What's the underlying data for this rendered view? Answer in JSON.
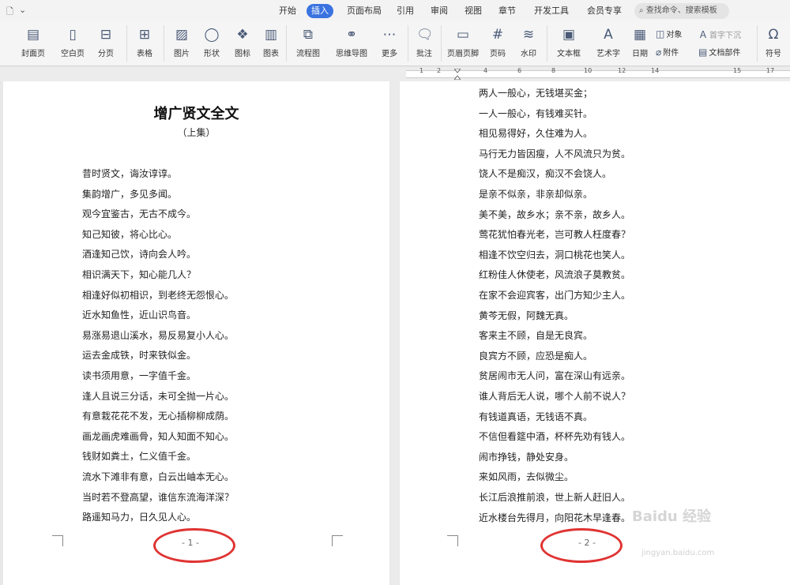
{
  "menubar": {
    "tabs": [
      {
        "label": "开始",
        "active": false
      },
      {
        "label": "插入",
        "active": true
      },
      {
        "label": "页面布局",
        "active": false
      },
      {
        "label": "引用",
        "active": false
      },
      {
        "label": "审阅",
        "active": false
      },
      {
        "label": "视图",
        "active": false
      },
      {
        "label": "章节",
        "active": false
      },
      {
        "label": "开发工具",
        "active": false
      },
      {
        "label": "会员专享",
        "active": false
      }
    ],
    "search_placeholder": "查找命令、搜索模板"
  },
  "ribbon": {
    "cover_page": "封面页",
    "blank_page": "空白页",
    "page_break": "分页",
    "table": "表格",
    "picture": "图片",
    "shape": "形状",
    "icon": "图标",
    "chart": "图表",
    "flowchart": "流程图",
    "mindmap": "思维导图",
    "more": "更多",
    "comment": "批注",
    "header_footer": "页眉页脚",
    "page_number": "页码",
    "watermark": "水印",
    "textbox": "文本框",
    "wordart": "艺术字",
    "date": "日期",
    "object": "对象",
    "attachment": "附件",
    "dropcap": "首字下沉",
    "doc_parts": "文档部件",
    "symbol": "符号"
  },
  "ruler": {
    "numbers": [
      "1",
      "2",
      "4",
      "6",
      "8",
      "10",
      "12",
      "14",
      "15",
      "17"
    ]
  },
  "page1": {
    "title": "增广贤文全文",
    "subtitle": "（上集）",
    "lines": [
      "昔时贤文，诲汝谆谆。",
      "集韵增广，多见多闻。",
      "观今宜鉴古，无古不成今。",
      "知己知彼，将心比心。",
      "酒逢知己饮，诗向会人吟。",
      "相识满天下，知心能几人？",
      "相逢好似初相识，到老终无怨恨心。",
      "近水知鱼性，近山识鸟音。",
      "易涨易退山溪水，易反易复小人心。",
      "运去金成铁，时来铁似金。",
      "读书须用意，一字值千金。",
      "逢人且说三分话，未可全抛一片心。",
      "有意栽花花不发，无心插柳柳成荫。",
      "画龙画虎难画骨，知人知面不知心。",
      "钱财如粪土，仁义值千金。",
      "流水下滩非有意，白云出岫本无心。",
      "当时若不登高望，谁信东流海洋深？",
      "路遥知马力，日久见人心。"
    ],
    "page_number": "- 1 -"
  },
  "page2": {
    "lines": [
      "两人一般心，无钱堪买金；",
      "一人一般心，有钱难买针。",
      "相见易得好，久住难为人。",
      "马行无力皆因瘦，人不风流只为贫。",
      "饶人不是痴汉，痴汉不会饶人。",
      "是亲不似亲，非亲却似亲。",
      "美不美，故乡水；亲不亲，故乡人。",
      "莺花犹怕春光老，岂可教人枉度春？",
      "相逢不饮空归去，洞口桃花也笑人。",
      "红粉佳人休使老，风流浪子莫教贫。",
      "在家不会迎宾客，出门方知少主人。",
      "黄芩无假，阿魏无真。",
      "客来主不顾，自是无良宾。",
      "良宾方不顾，应恐是痴人。",
      "贫居闹市无人问，富在深山有远亲。",
      "谁人背后无人说，哪个人前不说人？",
      "有钱道真语，无钱语不真。",
      "不信但看筵中酒，杯杯先劝有钱人。",
      "闹市挣钱，静处安身。",
      "来如风雨，去似微尘。",
      "长江后浪推前浪，世上新人赶旧人。",
      "近水楼台先得月，向阳花木早逢春。"
    ],
    "page_number": "- 2 -"
  },
  "watermark": {
    "brand": "Baidu 经验",
    "url": "jingyan.baidu.com"
  },
  "colors": {
    "accent": "#3a73e0",
    "highlight_circle": "#e03333"
  }
}
